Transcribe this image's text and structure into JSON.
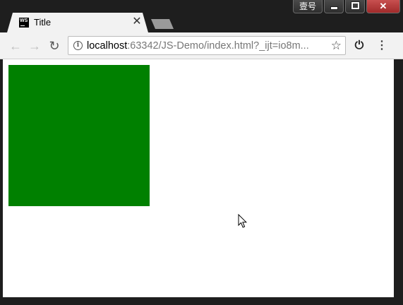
{
  "window": {
    "ime_label": "壹号",
    "close_glyph": "✕"
  },
  "tab": {
    "favicon_text": "WS",
    "title": "Title",
    "close_glyph": "✕"
  },
  "toolbar": {
    "back_glyph": "←",
    "forward_glyph": "→",
    "reload_glyph": "↻",
    "info_glyph": "i",
    "url_host": "localhost",
    "url_rest": ":63342/JS-Demo/index.html?_ijt=io8m...",
    "star_glyph": "☆",
    "power_glyph": "⏻",
    "menu_glyph": "⋮"
  },
  "page": {
    "box_color": "#008000",
    "background": "#ffffff"
  },
  "icons": {
    "favicon": "webstorm-icon",
    "tab_close": "close-icon",
    "back": "arrow-left-icon",
    "forward": "arrow-right-icon",
    "reload": "reload-icon",
    "info": "info-icon",
    "star": "star-icon",
    "power": "power-icon",
    "menu": "more-vertical-icon",
    "cursor": "mouse-pointer-icon"
  }
}
